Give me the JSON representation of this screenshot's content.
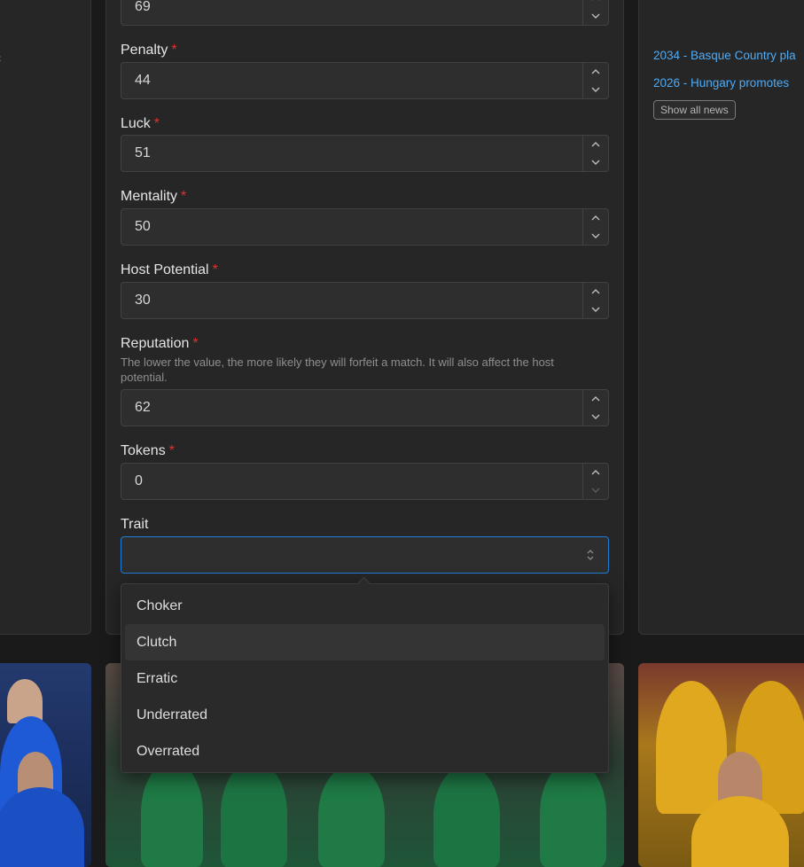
{
  "form": {
    "partial_field": {
      "value": "69"
    },
    "fields": [
      {
        "label": "Penalty",
        "required_mark": "*",
        "value": "44"
      },
      {
        "label": "Luck",
        "required_mark": "*",
        "value": "51"
      },
      {
        "label": "Mentality",
        "required_mark": "*",
        "value": "50"
      },
      {
        "label": "Host Potential",
        "required_mark": "*",
        "value": "30"
      },
      {
        "label": "Reputation",
        "required_mark": "*",
        "value": "62",
        "description": "The lower the value, the more likely they will forfeit a match. It will also affect the host potential."
      },
      {
        "label": "Tokens",
        "required_mark": "*",
        "value": "0"
      }
    ],
    "trait": {
      "label": "Trait",
      "value": "",
      "options": [
        "Choker",
        "Clutch",
        "Erratic",
        "Underrated",
        "Overrated"
      ],
      "highlighted_option": "Clutch"
    }
  },
  "news": {
    "items": [
      "2034 - Basque Country pla",
      "2026 - Hungary promotes"
    ],
    "show_all_label": "Show all news"
  },
  "colors": {
    "background": "#1a1a1a",
    "panel": "#262626",
    "link": "#4dabf7",
    "required": "#e03131",
    "focus_border": "#1c7ed6"
  },
  "icons": {
    "stepper_up": "chevron-up-icon",
    "stepper_down": "chevron-down-icon",
    "select": "selector-icon"
  }
}
